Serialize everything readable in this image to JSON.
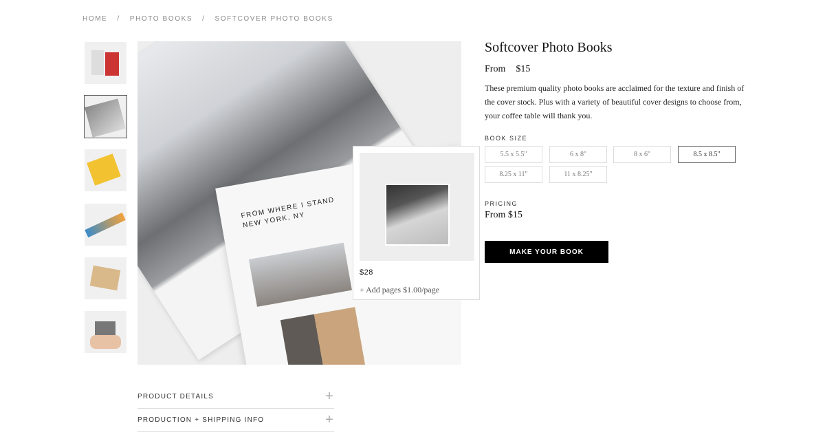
{
  "breadcrumb": [
    "HOME",
    "/",
    "PHOTO BOOKS",
    "/",
    "SOFTCOVER PHOTO BOOKS"
  ],
  "main_image": {
    "caption_line1": "FROM WHERE I STAND",
    "caption_line2": "NEW YORK, NY"
  },
  "thumbnails": {
    "count": 6,
    "selected_index": 1
  },
  "popup": {
    "price": "$28",
    "add_pages": "+ Add pages $1.00/page"
  },
  "product": {
    "title": "Softcover Photo Books",
    "from": "From  $15",
    "description": "These premium quality photo books are acclaimed for the texture and finish of the cover stock. Plus with a variety of beautiful cover designs to choose from, your coffee table will thank you."
  },
  "book_size": {
    "label": "BOOK SIZE",
    "options": [
      "5.5 x 5.5\"",
      "6 x 8\"",
      "8 x 6\"",
      "8.5 x 8.5\"",
      "8.25 x 11\"",
      "11 x 8.25\""
    ],
    "selected": "8.5 x 8.5\""
  },
  "pricing": {
    "label": "PRICING",
    "value": "From $15"
  },
  "cta": {
    "label": "MAKE YOUR BOOK"
  },
  "accordion": [
    {
      "label": "PRODUCT DETAILS",
      "icon": "plus-icon"
    },
    {
      "label": "PRODUCTION + SHIPPING INFO",
      "icon": "plus-icon"
    }
  ]
}
